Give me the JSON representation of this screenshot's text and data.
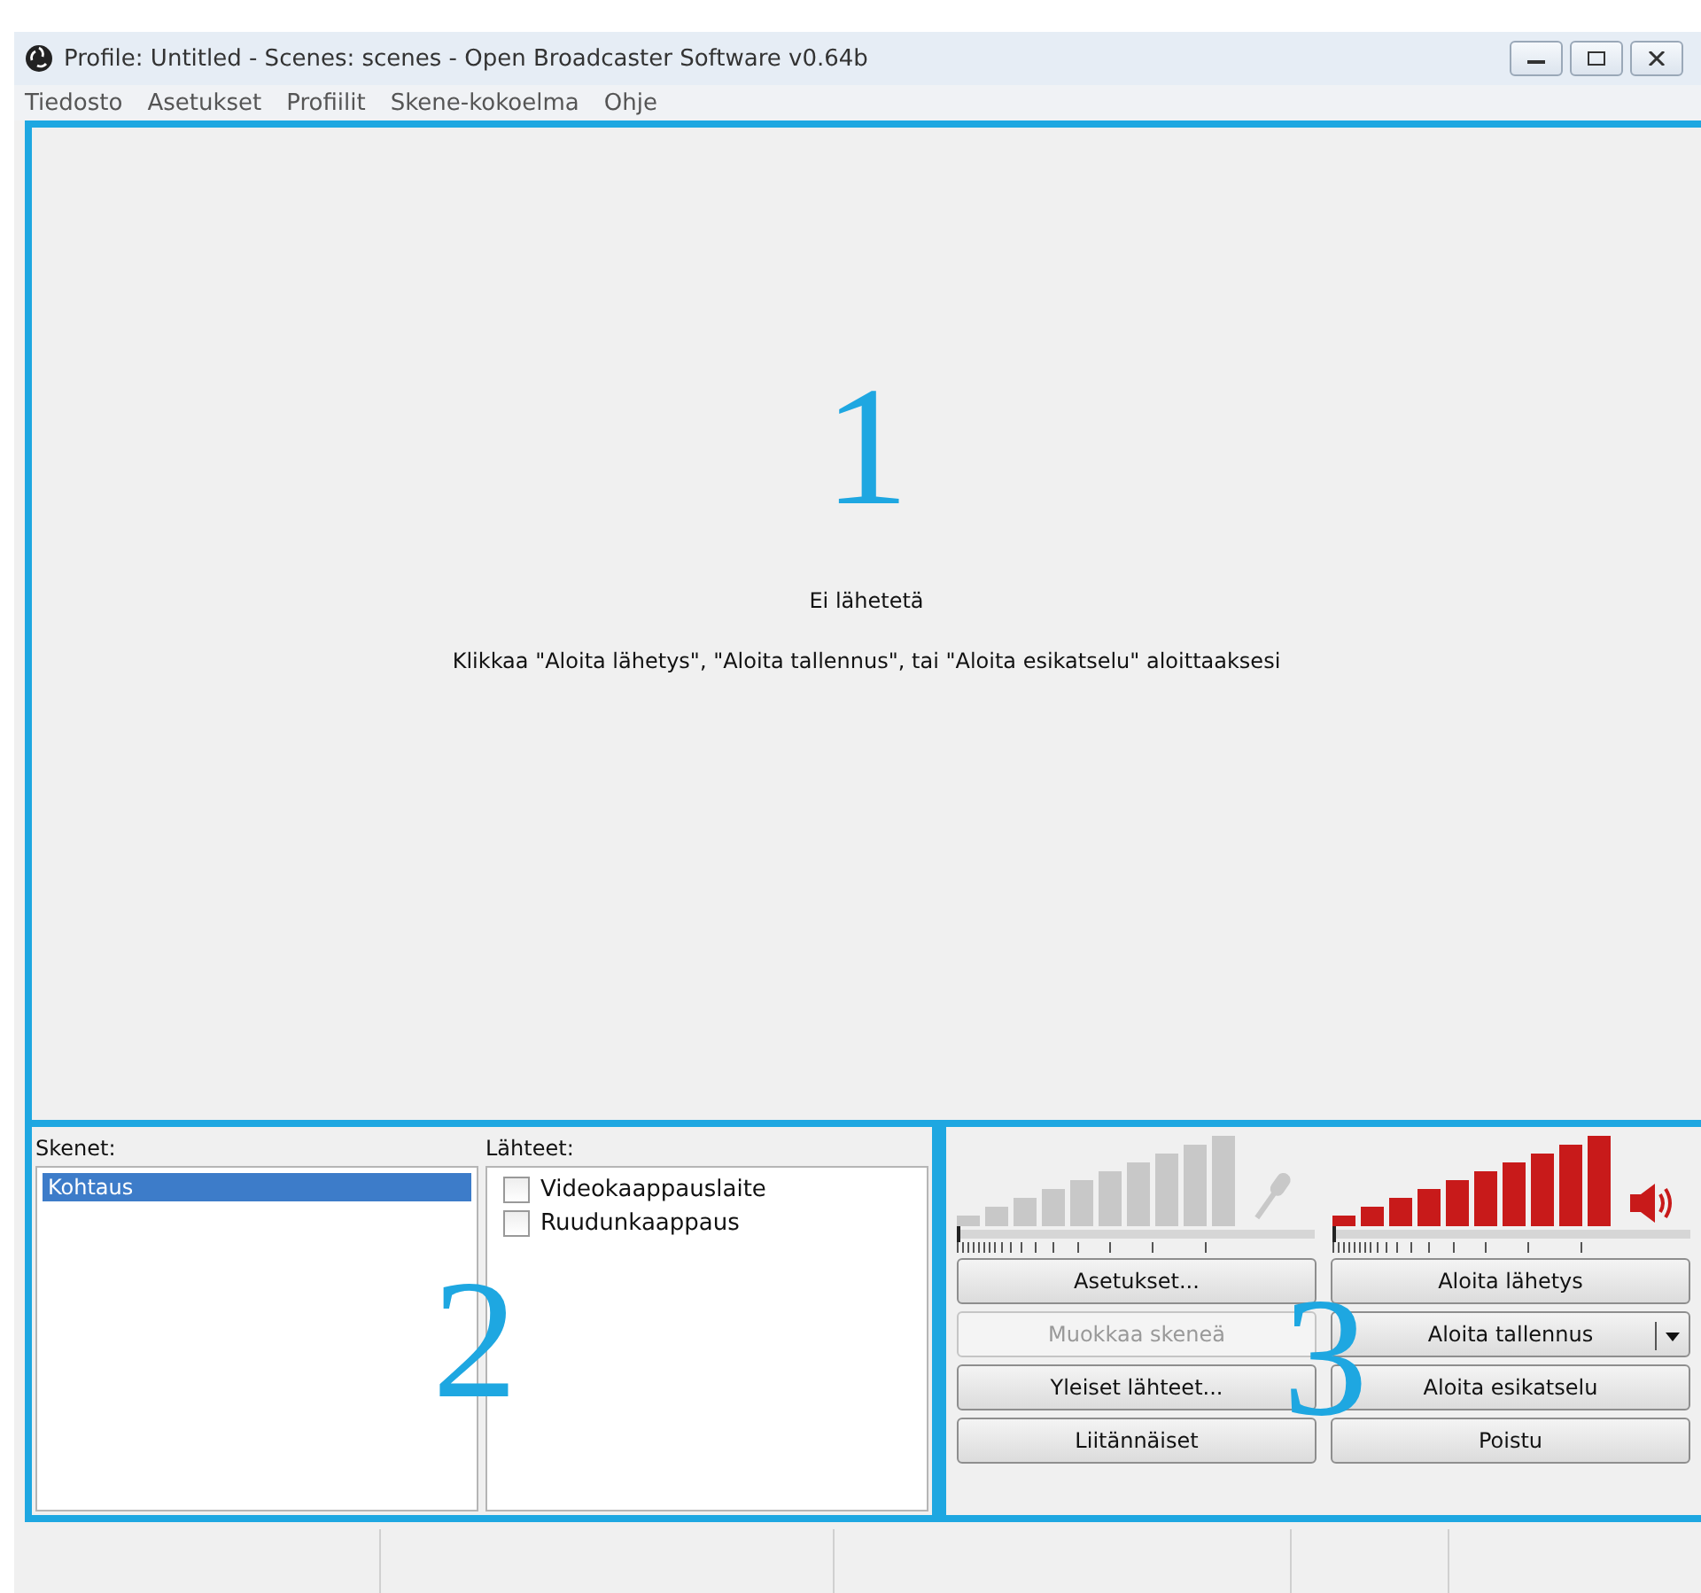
{
  "window": {
    "title": "Profile: Untitled - Scenes: scenes - Open Broadcaster Software v0.64b"
  },
  "menu": [
    "Tiedosto",
    "Asetukset",
    "Profiilit",
    "Skene-kokoelma",
    "Ohje"
  ],
  "preview": {
    "status": "Ei lähetetä",
    "hint": "Klikkaa \"Aloita lähetys\", \"Aloita tallennus\", tai \"Aloita esikatselu\" aloittaaksesi"
  },
  "scenes": {
    "label": "Skenet:",
    "items": [
      {
        "label": "Kohtaus",
        "selected": true
      }
    ]
  },
  "sources": {
    "label": "Lähteet:",
    "items": [
      {
        "label": "Videokaappauslaite",
        "checked": false
      },
      {
        "label": "Ruudunkaappaus",
        "checked": false
      }
    ]
  },
  "meters": [
    {
      "kind": "microphone",
      "muted": true,
      "level": 0
    },
    {
      "kind": "speaker",
      "muted": false,
      "level": 0
    }
  ],
  "buttons": [
    {
      "label": "Asetukset...",
      "disabled": false,
      "dropdown": false
    },
    {
      "label": "Aloita lähetys",
      "disabled": false,
      "dropdown": false
    },
    {
      "label": "Muokkaa skeneä",
      "disabled": true,
      "dropdown": false
    },
    {
      "label": "Aloita tallennus",
      "disabled": false,
      "dropdown": true
    },
    {
      "label": "Yleiset lähteet...",
      "disabled": false,
      "dropdown": false
    },
    {
      "label": "Aloita esikatselu",
      "disabled": false,
      "dropdown": false
    },
    {
      "label": "Liitännäiset",
      "disabled": false,
      "dropdown": false
    },
    {
      "label": "Poistu",
      "disabled": false,
      "dropdown": false
    }
  ],
  "annotations": [
    "1",
    "2",
    "3"
  ]
}
